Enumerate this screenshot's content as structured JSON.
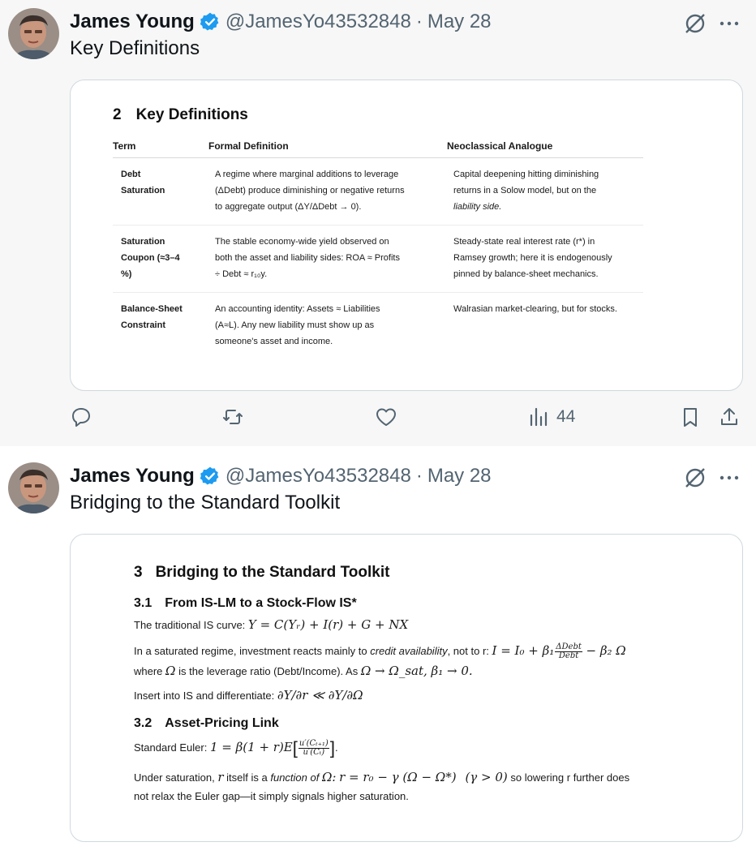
{
  "tweets": [
    {
      "author": {
        "name": "James Young",
        "handle": "@JamesYo43532848",
        "date": "May 28"
      },
      "text": "Key Definitions",
      "stats": {
        "views": "44"
      },
      "doc": {
        "section_number": "2",
        "section_title": "Key Definitions",
        "columns": [
          "Term",
          "Formal Definition",
          "Neoclassical Analogue"
        ],
        "rows": [
          {
            "term": [
              "Debt",
              "Saturation"
            ],
            "formal": [
              "A regime where marginal additions to leverage",
              "(ΔDebt) produce diminishing or negative returns",
              "to aggregate output (ΔY/ΔDebt → 0)."
            ],
            "analogue": [
              "Capital deepening hitting diminishing",
              "returns in a Solow model, but on the",
              "liability side."
            ]
          },
          {
            "term": [
              "Saturation",
              "Coupon (≈3–4",
              "%)"
            ],
            "formal": [
              "The stable economy-wide yield observed on",
              "both the asset and liability sides: ROA ≈ Profits",
              "÷ Debt ≈ r₁₀y."
            ],
            "analogue": [
              "Steady-state real interest rate (r*) in",
              "Ramsey growth; here it is endogenously",
              "pinned by balance-sheet mechanics."
            ]
          },
          {
            "term": [
              "Balance-Sheet",
              "Constraint"
            ],
            "formal": [
              "An accounting identity: Assets ≈ Liabilities",
              "(A≈L). Any new liability must show up as",
              "someone's asset and income."
            ],
            "analogue": [
              "Walrasian market-clearing, but for stocks."
            ]
          }
        ]
      }
    },
    {
      "author": {
        "name": "James Young",
        "handle": "@JamesYo43532848",
        "date": "May 28"
      },
      "text": "Bridging to the Standard Toolkit",
      "doc": {
        "section_number": "3",
        "section_title": "Bridging to the Standard Toolkit",
        "sub1_number": "3.1",
        "sub1_title": "From IS-LM to a Stock-Flow IS*",
        "is_curve_label": "The traditional IS curve:",
        "is_curve_formula": "Y = C(Yᵣ) + I(r) + G + NX",
        "investment_text_a": "In a saturated regime, investment reacts mainly to",
        "investment_text_em": "credit availability",
        "investment_text_b": ", not to r:",
        "investment_formula_lhs": "I = I₀ + β₁",
        "investment_frac_num": "ΔDebt",
        "investment_frac_den": "Debt",
        "investment_formula_rhs": "− β₂ Ω",
        "where_text_a": "where",
        "where_omega": "Ω",
        "where_text_b": "is the leverage ratio (Debt/Income). As",
        "where_formula": "Ω → Ω_sat, β₁ → 0.",
        "insert_text": "Insert into IS and differentiate:",
        "insert_formula": "∂Y/∂r ≪ ∂Y/∂Ω",
        "sub2_number": "3.2",
        "sub2_title": "Asset-Pricing Link",
        "euler_label": "Standard Euler:",
        "euler_formula": "1 = β(1 + r)E",
        "euler_num": "u′(Cₜ₊₁)",
        "euler_den": "u′(Cₜ)",
        "under_text_a": "Under saturation,",
        "under_r": "r",
        "under_text_b": "itself is a",
        "under_em": "function of",
        "under_omega": "Ω:",
        "under_formula": "r = r₀ − γ (Ω − Ω*)",
        "under_cond": "(γ > 0)",
        "under_text_c": "so lowering r further does",
        "under_line2": "not relax the Euler gap—it simply signals higher saturation."
      }
    }
  ],
  "colors": {
    "verified": "#1d9bf0",
    "muted": "#536471",
    "tweet1_bg": "#f7f7f7"
  },
  "icons": [
    "verified-badge-icon",
    "grok-icon",
    "more-icon",
    "reply-icon",
    "retweet-icon",
    "like-icon",
    "views-icon",
    "bookmark-icon",
    "share-icon"
  ]
}
